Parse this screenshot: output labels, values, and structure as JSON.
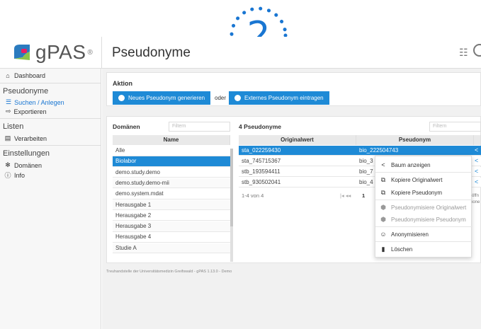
{
  "step_badge": "2",
  "header": {
    "logo_text": "gPAS",
    "logo_reg": "®",
    "page_title": "Pseudonyme"
  },
  "sidebar": {
    "dashboard": "Dashboard",
    "section_pseudonyme": "Pseudonyme",
    "suchen": "Suchen / Anlegen",
    "exportieren": "Exportieren",
    "section_listen": "Listen",
    "verarbeiten": "Verarbeiten",
    "section_einstellungen": "Einstellungen",
    "domaenen": "Domänen",
    "info": "Info"
  },
  "aktion": {
    "title": "Aktion",
    "btn_neu": "Neues Pseudonym generieren",
    "oder": "oder",
    "btn_extern": "Externes Pseudonym eintragen"
  },
  "domaenen_panel": {
    "title": "Domänen",
    "filter_placeholder": "Filtern",
    "column": "Name",
    "rows": [
      "Alle",
      "Biolabor",
      "demo.study.demo",
      "demo.study.demo-mii",
      "demo.system.mdat",
      "Herausgabe 1",
      "Herausgabe 2",
      "Herausgabe 3",
      "Herausgabe 4",
      "Studie A"
    ]
  },
  "pseudonyme_panel": {
    "title": "4 Pseudonyme",
    "filter_placeholder": "Filtern",
    "col_original": "Originalwert",
    "col_pseudonym": "Pseudonym",
    "rows": [
      {
        "original": "sta_022259430",
        "pseudonym": "bio_222504743"
      },
      {
        "original": "sta_745715367",
        "pseudonym": "bio_3"
      },
      {
        "original": "stb_193594411",
        "pseudonym": "bio_7"
      },
      {
        "original": "stb_930502041",
        "pseudonym": "bio_4"
      }
    ],
    "pager_text": "1-4 von 4",
    "pager_page": "1",
    "pager_nav": "|◂ ◂◂",
    "side_text1": "öffn",
    "side_text2": "ione"
  },
  "context_menu": {
    "baum": "Baum anzeigen",
    "kopiere_original": "Kopiere Originalwert",
    "kopiere_pseudonym": "Kopiere Pseudonym",
    "pseudonymisiere_original": "Pseudonymisiere Originalwert",
    "pseudonymisiere_pseudonym": "Pseudonymisiere Pseudonym",
    "anonymisieren": "Anonymisieren",
    "loeschen": "Löschen"
  },
  "footer": "Treuhandstelle der Universitätsmedizin Greifswald - gPAS 1.13.0 - Demo",
  "colors": {
    "accent": "#1e8ad6",
    "badge": "#1976d2"
  }
}
